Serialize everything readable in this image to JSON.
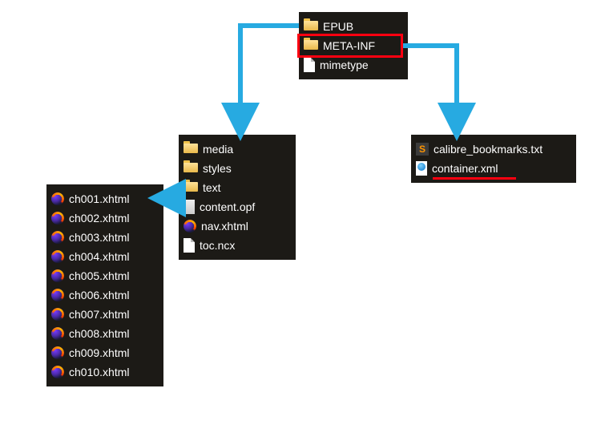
{
  "root_panel": {
    "items": [
      {
        "name": "EPUB",
        "icon": "folder"
      },
      {
        "name": "META-INF",
        "icon": "folder",
        "highlighted": true
      },
      {
        "name": "mimetype",
        "icon": "file"
      }
    ]
  },
  "metainf_panel": {
    "items": [
      {
        "name": "calibre_bookmarks.txt",
        "icon": "sublime"
      },
      {
        "name": "container.xml",
        "icon": "web",
        "underlined": true
      }
    ]
  },
  "epub_panel": {
    "items": [
      {
        "name": "media",
        "icon": "folder"
      },
      {
        "name": "styles",
        "icon": "folder"
      },
      {
        "name": "text",
        "icon": "folder"
      },
      {
        "name": "content.opf",
        "icon": "file"
      },
      {
        "name": "nav.xhtml",
        "icon": "firefox"
      },
      {
        "name": "toc.ncx",
        "icon": "file"
      }
    ]
  },
  "text_panel": {
    "items": [
      {
        "name": "ch001.xhtml",
        "icon": "firefox"
      },
      {
        "name": "ch002.xhtml",
        "icon": "firefox"
      },
      {
        "name": "ch003.xhtml",
        "icon": "firefox"
      },
      {
        "name": "ch004.xhtml",
        "icon": "firefox"
      },
      {
        "name": "ch005.xhtml",
        "icon": "firefox"
      },
      {
        "name": "ch006.xhtml",
        "icon": "firefox"
      },
      {
        "name": "ch007.xhtml",
        "icon": "firefox"
      },
      {
        "name": "ch008.xhtml",
        "icon": "firefox"
      },
      {
        "name": "ch009.xhtml",
        "icon": "firefox"
      },
      {
        "name": "ch010.xhtml",
        "icon": "firefox"
      }
    ]
  },
  "colors": {
    "arrow": "#27aae1",
    "highlight": "#ff0010",
    "panel_bg": "#1c1a16"
  }
}
